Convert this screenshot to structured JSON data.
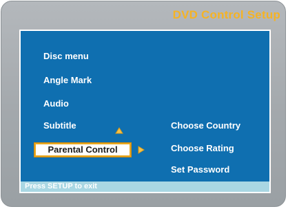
{
  "title": "DVD Control Setup",
  "menu": [
    {
      "label": "Disc menu"
    },
    {
      "label": "Angle Mark"
    },
    {
      "label": "Audio"
    },
    {
      "label": "Subtitle"
    },
    {
      "label": "Parental Control"
    }
  ],
  "submenu": [
    {
      "label": "Choose Country"
    },
    {
      "label": "Choose Rating"
    },
    {
      "label": "Set Password"
    }
  ],
  "status": "Press SETUP to exit",
  "colors": {
    "title": "#f5b324",
    "screen": "#0f6fb0",
    "status_bar": "#a9d7e3",
    "highlight_border": "#e8a820"
  }
}
